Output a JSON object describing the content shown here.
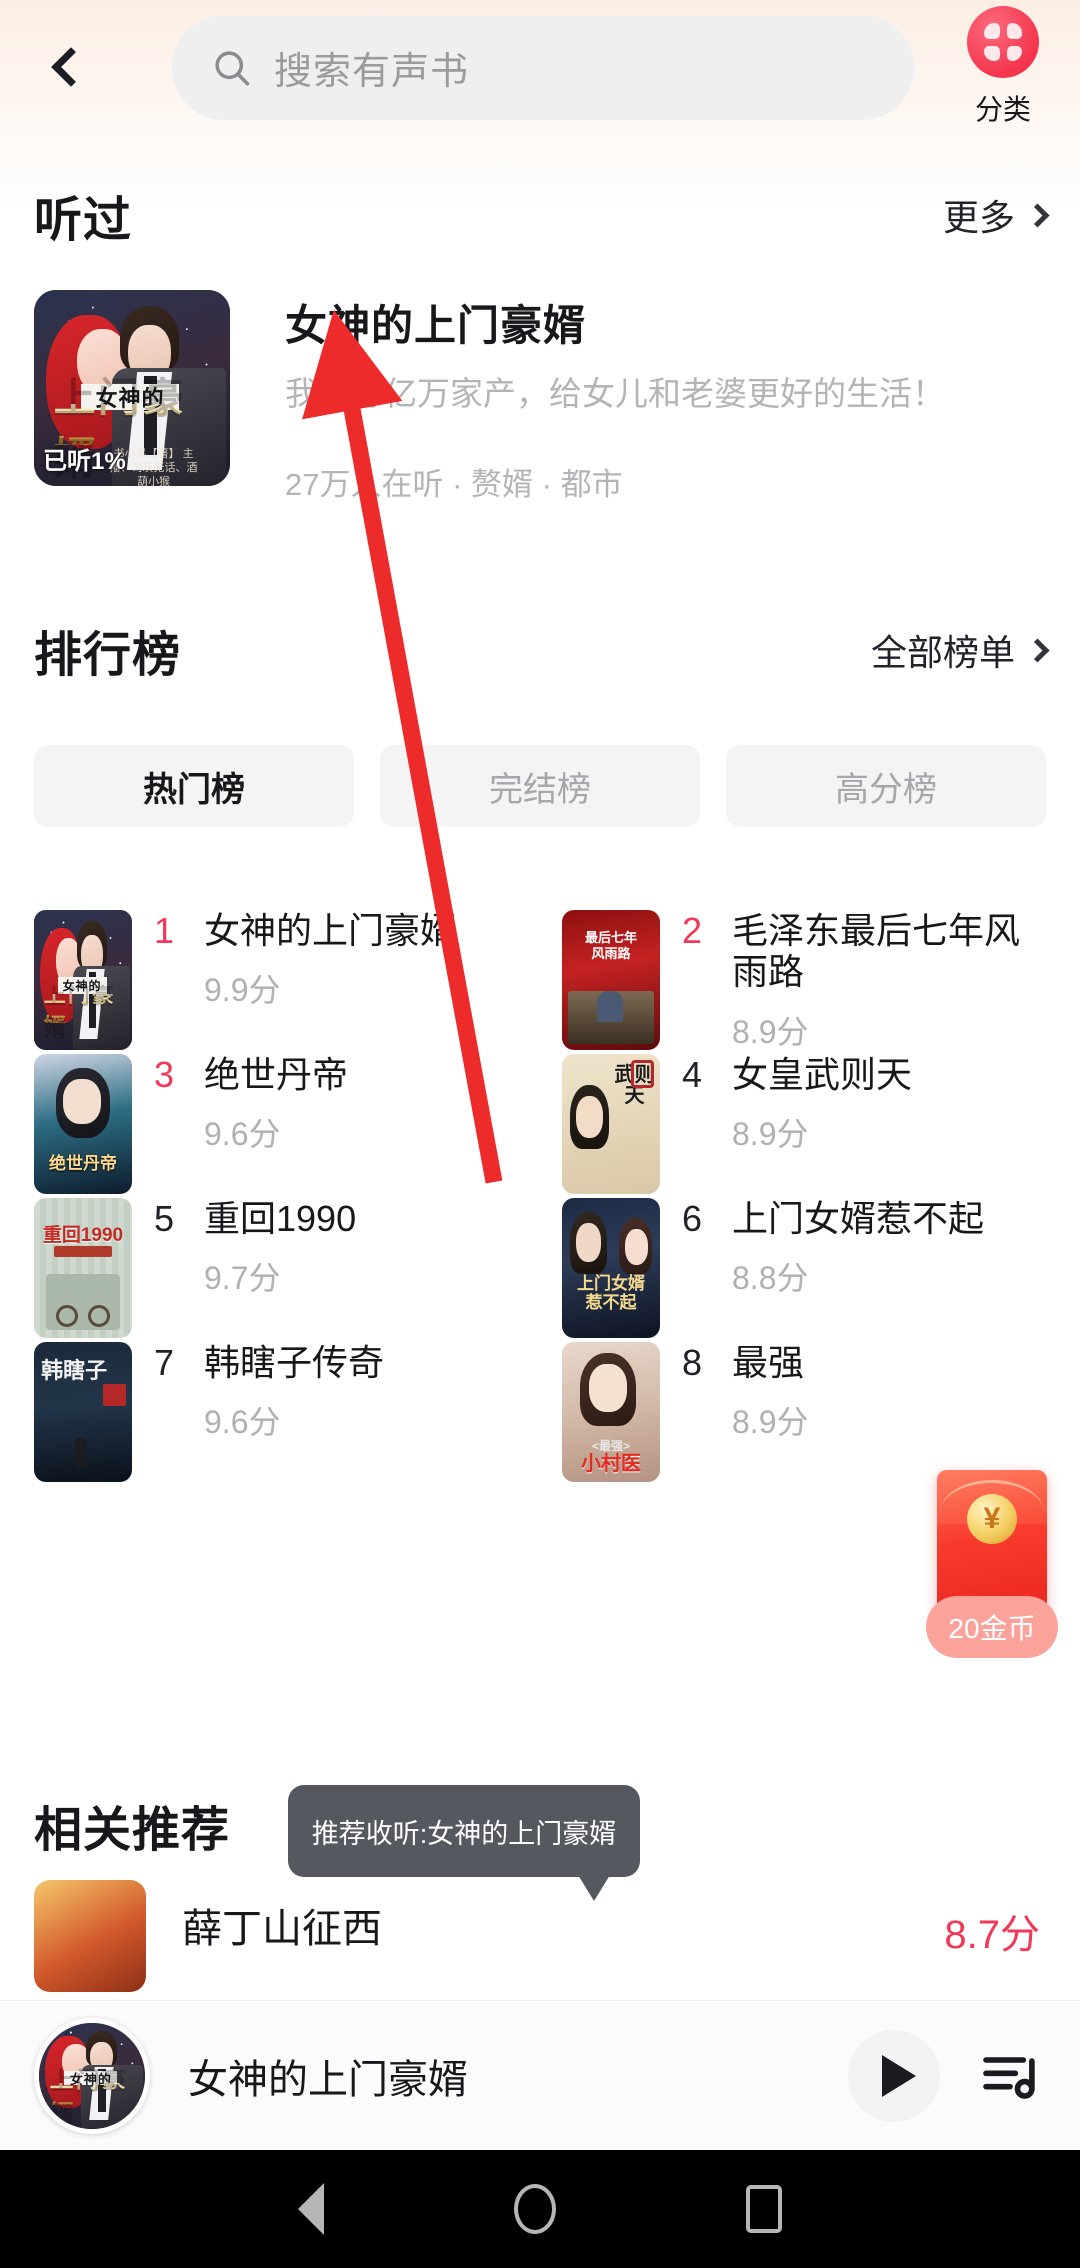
{
  "header": {
    "back_icon": "chevron-left-icon",
    "search": {
      "icon": "search-icon",
      "placeholder": "搜索有声书",
      "value": ""
    },
    "category": {
      "icon": "grid-category-icon",
      "label": "分类",
      "color": "#f5384f"
    }
  },
  "sections": {
    "heard": {
      "title": "听过",
      "more_label": "更多",
      "more_icon": "chevron-right-icon"
    },
    "rank": {
      "title": "排行榜",
      "more_label": "全部榜单",
      "more_icon": "chevron-right-icon"
    },
    "recommend": {
      "title": "相关推荐"
    }
  },
  "heard_item": {
    "title": "女神的上门豪婿",
    "desc": "我要分亿万家产，给女儿和老婆更好的生活！",
    "meta": "27万人在听 · 赘婿 · 都市",
    "progress_label": "已听1%",
    "cover": {
      "line1": "女神的",
      "line2": "上门豪婿",
      "author": "书小呆【著】\n主播：司灰无话、酒葫小猴"
    }
  },
  "rank_tabs": [
    {
      "label": "热门榜",
      "active": true
    },
    {
      "label": "完结榜",
      "active": false
    },
    {
      "label": "高分榜",
      "active": false
    }
  ],
  "rank_items": [
    {
      "num": "1",
      "title": "女神的上门豪婿",
      "score": "9.9分",
      "hot": true
    },
    {
      "num": "2",
      "title": "毛泽东最后七年风雨路",
      "score": "8.9分",
      "hot": true
    },
    {
      "num": "3",
      "title": "绝世丹帝",
      "score": "9.6分",
      "hot": true
    },
    {
      "num": "4",
      "title": "女皇武则天",
      "score": "8.9分",
      "hot": false
    },
    {
      "num": "5",
      "title": "重回1990",
      "score": "9.7分",
      "hot": false
    },
    {
      "num": "6",
      "title": "上门女婿惹不起",
      "score": "8.8分",
      "hot": false
    },
    {
      "num": "7",
      "title": "韩瞎子传奇",
      "score": "9.6分",
      "hot": false
    },
    {
      "num": "8",
      "title": "最强",
      "score": "8.9分",
      "hot": false
    }
  ],
  "recommend_item": {
    "title": "薛丁山征西",
    "score": "8.7分"
  },
  "red_packet": {
    "icon": "red-envelope-icon",
    "coin_symbol": "¥",
    "amount_label": "20金币"
  },
  "tooltip": {
    "text": "推荐收听:女神的上门豪婿"
  },
  "player": {
    "title": "女神的上门豪婿",
    "play_icon": "play-icon",
    "playlist_icon": "playlist-icon"
  },
  "navbar": {
    "back_icon": "nav-back-icon",
    "home_icon": "nav-home-icon",
    "recents_icon": "nav-recents-icon"
  },
  "colors": {
    "accent": "#f0395a",
    "brand_red": "#f5384f",
    "muted": "#b4b4b8"
  }
}
